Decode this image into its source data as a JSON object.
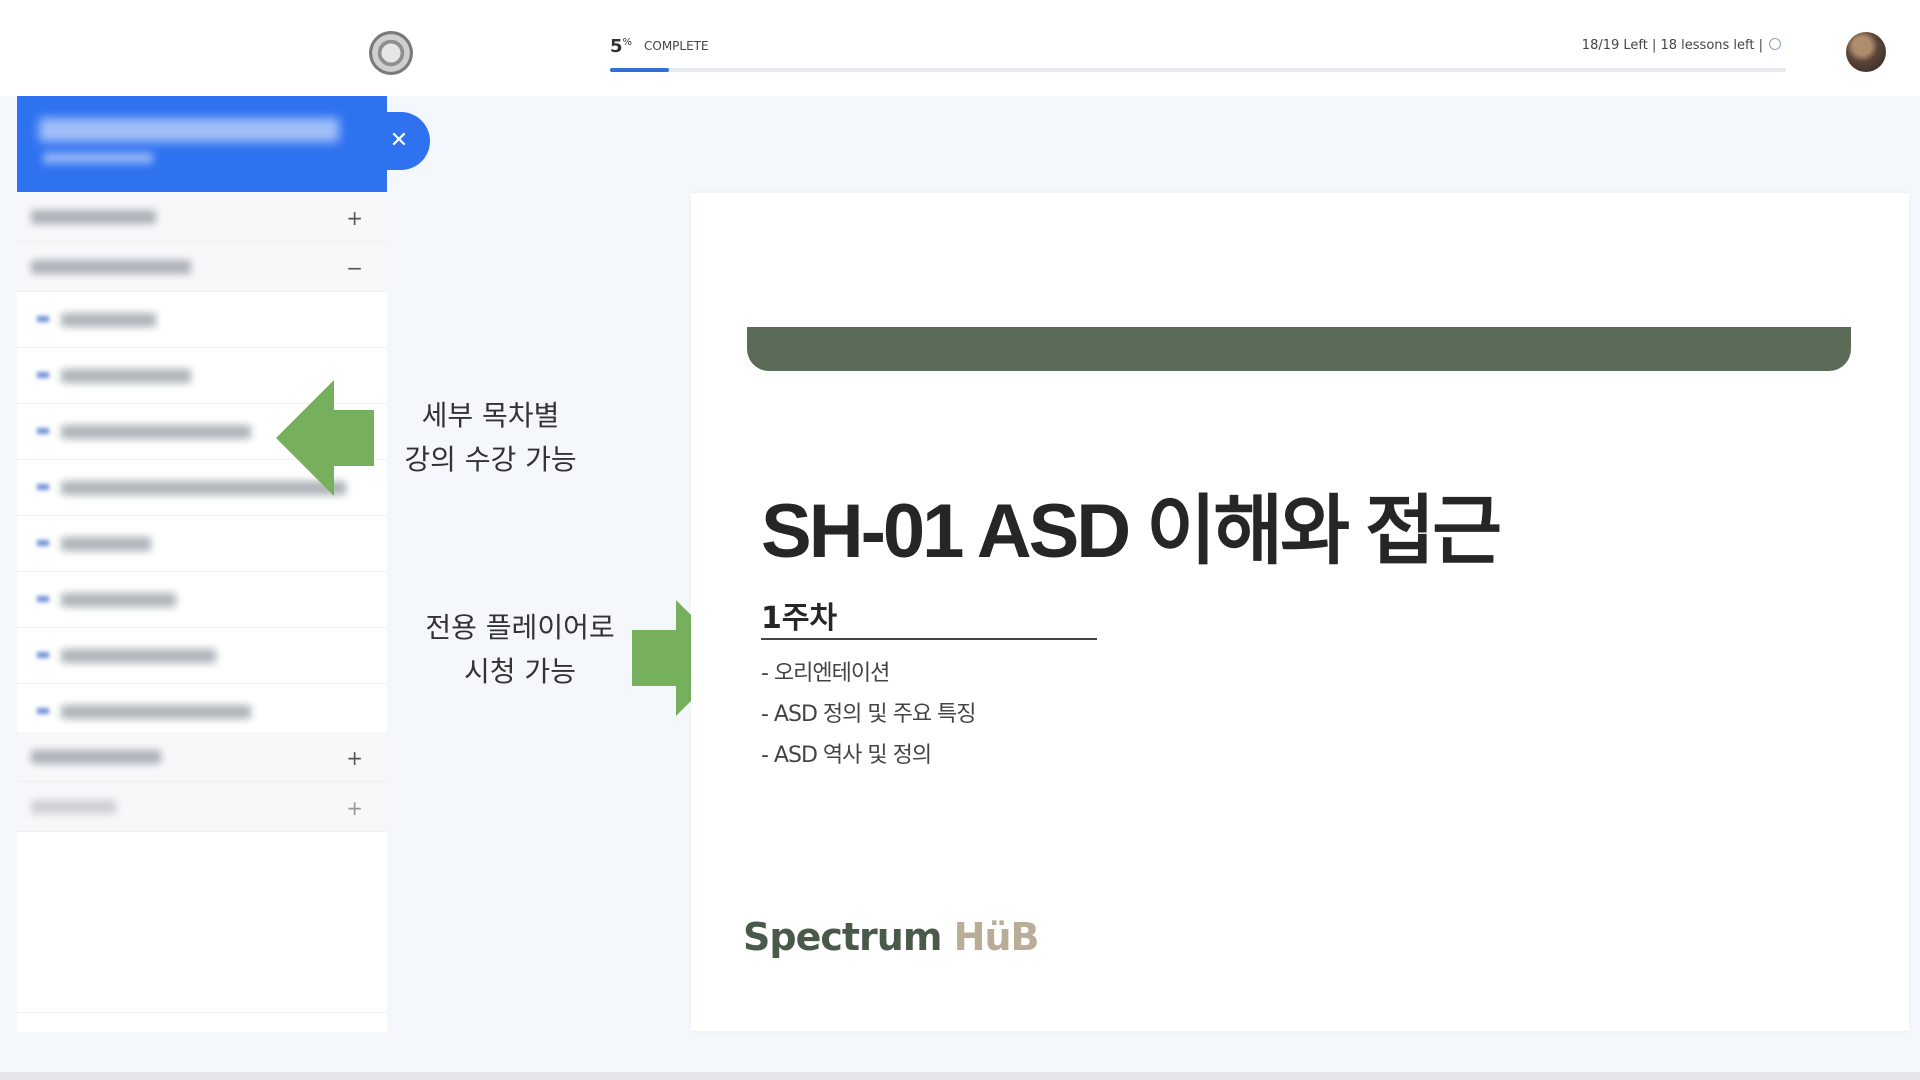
{
  "topbar": {
    "logo": "logo-badge",
    "progress": {
      "percent_value": "5",
      "percent_symbol": "%",
      "complete_label": "COMPLETE",
      "fraction": 0.05
    },
    "lessons_info": "18/19 Left |  18 lessons left |"
  },
  "sidebar": {
    "close_label": "✕",
    "sections": [
      {
        "expand_icon": "+"
      },
      {
        "expand_icon": "−"
      },
      {
        "expand_icon": "+"
      },
      {
        "expand_icon": "+"
      }
    ]
  },
  "annotations": {
    "toc": {
      "line1": "세부 목차별",
      "line2": "강의 수강 가능"
    },
    "player": {
      "line1": "전용 플레이어로",
      "line2": "시청 가능"
    },
    "arrow_color": "#76b05d"
  },
  "slide": {
    "title": "SH-01 ASD 이해와 접근",
    "week": "1주차",
    "topics": [
      "- 오리엔테이션",
      "- ASD 정의 및 주요 특징",
      "- ASD 역사 및 정의"
    ],
    "brand_part1": "Spectrum",
    "brand_part2": "HüB",
    "bar_color": "#5b6b58"
  },
  "colors": {
    "accent": "#2f72f0",
    "progress": "#2f6fd6"
  }
}
